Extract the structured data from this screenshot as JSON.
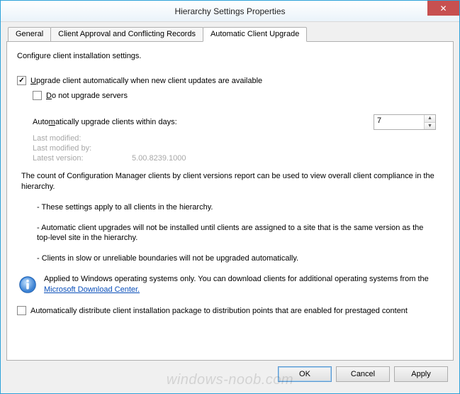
{
  "window": {
    "title": "Hierarchy Settings Properties",
    "close_glyph": "✕"
  },
  "tabs": [
    {
      "label": "General"
    },
    {
      "label": "Client Approval and Conflicting Records"
    },
    {
      "label": "Automatic Client Upgrade"
    }
  ],
  "panel": {
    "intro": "Configure client installation settings.",
    "upgrade_auto": {
      "checked": true,
      "prefix": "U",
      "label_rest": "pgrade client automatically when new client updates are available"
    },
    "no_servers": {
      "checked": false,
      "prefix": "D",
      "label_rest": "o not upgrade servers"
    },
    "days": {
      "label_pre": "Auto",
      "label_mid": "m",
      "label_post": "atically upgrade clients within days:",
      "value": "7"
    },
    "meta": {
      "last_modified_k": "Last modified:",
      "last_modified_v": "",
      "last_modified_by_k": "Last modified by:",
      "last_modified_by_v": "",
      "latest_version_k": "Latest version:",
      "latest_version_v": "5.00.8239.1000"
    },
    "note": "The count of Configuration Manager clients by client versions report can be used to view overall client compliance in the hierarchy.",
    "bullets": [
      "- These settings apply to all clients in the hierarchy.",
      "- Automatic client upgrades will not be installed until clients are assigned to a site that is the same version as the top-level site in the hierarchy.",
      "- Clients in slow or unreliable boundaries will not be upgraded automatically."
    ],
    "info": {
      "text_pre": "Applied to Windows operating systems only. You can download clients for additional operating systems from the ",
      "link": "Microsoft Download Center."
    },
    "prestaged": {
      "checked": false,
      "label": "Automatically distribute client installation package to distribution points that are enabled for prestaged content"
    }
  },
  "buttons": {
    "ok": "OK",
    "cancel": "Cancel",
    "apply": "Apply"
  },
  "watermark": "windows-noob.com"
}
